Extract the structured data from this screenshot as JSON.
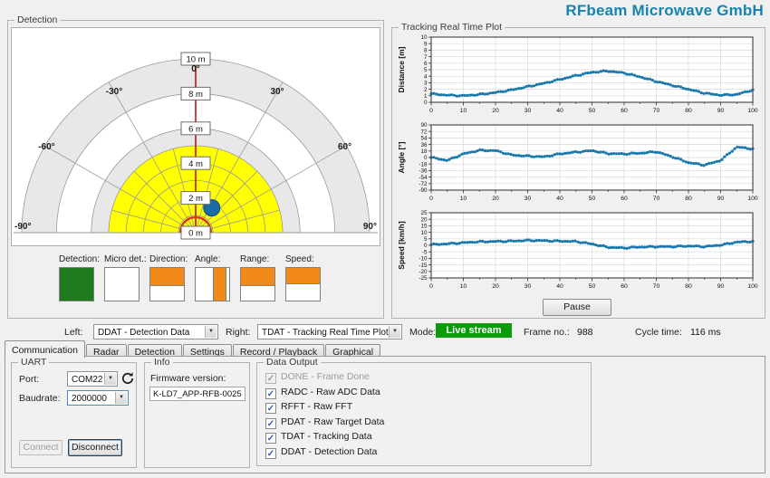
{
  "brand": "RFbeam Microwave GmbH",
  "icons": {
    "dropdown_arrow": "▼",
    "check": "✓"
  },
  "detection": {
    "title": "Detection",
    "max_range_m": 10,
    "detection_zone_m": 5,
    "range_rings": [
      {
        "r": 10,
        "label": "10 m"
      },
      {
        "r": 8,
        "label": "8 m"
      },
      {
        "r": 6,
        "label": "6 m"
      },
      {
        "r": 4,
        "label": "4 m"
      },
      {
        "r": 2,
        "label": "2 m"
      },
      {
        "r": 0,
        "label": "0 m"
      }
    ],
    "angle_marks": [
      {
        "deg": 0,
        "label": "0°"
      },
      {
        "deg": -30,
        "label": "-30°"
      },
      {
        "deg": 30,
        "label": "30°"
      },
      {
        "deg": -60,
        "label": "-60°"
      },
      {
        "deg": 60,
        "label": "60°"
      },
      {
        "deg": -90,
        "label": "-90°"
      },
      {
        "deg": 90,
        "label": "90°"
      }
    ],
    "target": {
      "range_m": 1.7,
      "angle_deg": 33
    },
    "colors": {
      "zone": "#ffff00",
      "band": "#e8e8e8",
      "ring": "#9a9a9a",
      "beam_line": "#c11212",
      "micro_zone": "#d8321a",
      "target": "#1b6ca3",
      "indicator_orange": "#f18a19",
      "indicator_green": "#1e7b1e"
    },
    "indicators": [
      {
        "label": "Detection:",
        "type": "fill"
      },
      {
        "label": "Micro det.:",
        "type": "empty"
      },
      {
        "label": "Direction:",
        "type": "hsplit",
        "fraction": 0.55
      },
      {
        "label": "Angle:",
        "type": "vbar",
        "from": 0.5,
        "to": 0.92
      },
      {
        "label": "Range:",
        "type": "hsplit",
        "fraction": 0.55
      },
      {
        "label": "Speed:",
        "type": "hsplit",
        "fraction": 0.5
      }
    ]
  },
  "tracking": {
    "title": "Tracking Real Time Plot",
    "pause_label": "Pause"
  },
  "chart_data": [
    {
      "type": "scatter",
      "ylabel": "Distance [m]",
      "ylim": [
        0,
        10
      ],
      "ystep": 1,
      "xlim": [
        0,
        100
      ],
      "xstep": 10,
      "grid": true,
      "series_color": "#1878ad",
      "x": [
        0,
        5,
        10,
        15,
        20,
        25,
        30,
        35,
        40,
        45,
        50,
        55,
        60,
        65,
        70,
        75,
        80,
        85,
        90,
        95,
        100
      ],
      "values": [
        1.3,
        1.1,
        1.0,
        1.2,
        1.5,
        1.9,
        2.4,
        2.9,
        3.5,
        4.1,
        4.6,
        4.8,
        4.5,
        3.9,
        3.2,
        2.6,
        2.0,
        1.4,
        1.1,
        1.2,
        1.9
      ]
    },
    {
      "type": "scatter",
      "ylabel": "Angle [°]",
      "ylim": [
        -90,
        90
      ],
      "ystep": 18,
      "xlim": [
        0,
        100
      ],
      "xstep": 10,
      "grid": true,
      "series_color": "#1878ad",
      "x": [
        0,
        5,
        10,
        15,
        20,
        25,
        30,
        35,
        40,
        45,
        50,
        55,
        60,
        65,
        70,
        75,
        80,
        85,
        90,
        95,
        100
      ],
      "values": [
        0,
        -8,
        10,
        20,
        19,
        7,
        4,
        2,
        10,
        15,
        19,
        11,
        10,
        12,
        16,
        2,
        -14,
        -21,
        -8,
        29,
        24
      ]
    },
    {
      "type": "scatter",
      "ylabel": "Speed [km/h]",
      "ylim": [
        -25,
        25
      ],
      "ystep": 5,
      "xlim": [
        0,
        100
      ],
      "xstep": 10,
      "grid": true,
      "series_color": "#1878ad",
      "x": [
        0,
        5,
        10,
        15,
        20,
        25,
        30,
        35,
        40,
        45,
        50,
        55,
        60,
        65,
        70,
        75,
        80,
        85,
        90,
        95,
        100
      ],
      "values": [
        0.5,
        1.2,
        2.0,
        2.8,
        3.0,
        3.2,
        3.8,
        3.6,
        3.2,
        3.0,
        1.0,
        -1.5,
        -2.0,
        -1.3,
        -1.0,
        -1.0,
        -0.5,
        -1.0,
        0.2,
        2.5,
        3.0
      ]
    }
  ],
  "control_bar": {
    "left_label": "Left:",
    "left_value": "DDAT - Detection Data",
    "right_label": "Right:",
    "right_value": "TDAT - Tracking Real Time Plot",
    "mode_label": "Mode:",
    "mode_value": "Live stream",
    "mode_color": "#0a9a0a",
    "frame_label": "Frame no.:",
    "frame_value": "988",
    "cycle_label": "Cycle time:",
    "cycle_value": "116 ms"
  },
  "tabs": [
    {
      "label": "Communication",
      "active": true
    },
    {
      "label": "Radar",
      "active": false
    },
    {
      "label": "Detection",
      "active": false
    },
    {
      "label": "Settings",
      "active": false
    },
    {
      "label": "Record / Playback",
      "active": false
    },
    {
      "label": "Graphical",
      "active": false
    }
  ],
  "communication": {
    "uart": {
      "title": "UART",
      "port_label": "Port:",
      "port_value": "COM22",
      "baud_label": "Baudrate:",
      "baud_value": "2000000",
      "connect_label": "Connect",
      "disconnect_label": "Disconnect"
    },
    "info": {
      "title": "Info",
      "firmware_label": "Firmware version:",
      "firmware_value": "K-LD7_APP-RFB-0025"
    },
    "data_output": {
      "title": "Data Output",
      "options": [
        {
          "label": "DONE - Frame Done",
          "checked": true,
          "disabled": true
        },
        {
          "label": "RADC - Raw ADC Data",
          "checked": true,
          "disabled": false
        },
        {
          "label": "RFFT - Raw FFT",
          "checked": true,
          "disabled": false
        },
        {
          "label": "PDAT - Raw Target Data",
          "checked": true,
          "disabled": false
        },
        {
          "label": "TDAT - Tracking Data",
          "checked": true,
          "disabled": false
        },
        {
          "label": "DDAT - Detection Data",
          "checked": true,
          "disabled": false
        }
      ]
    }
  }
}
